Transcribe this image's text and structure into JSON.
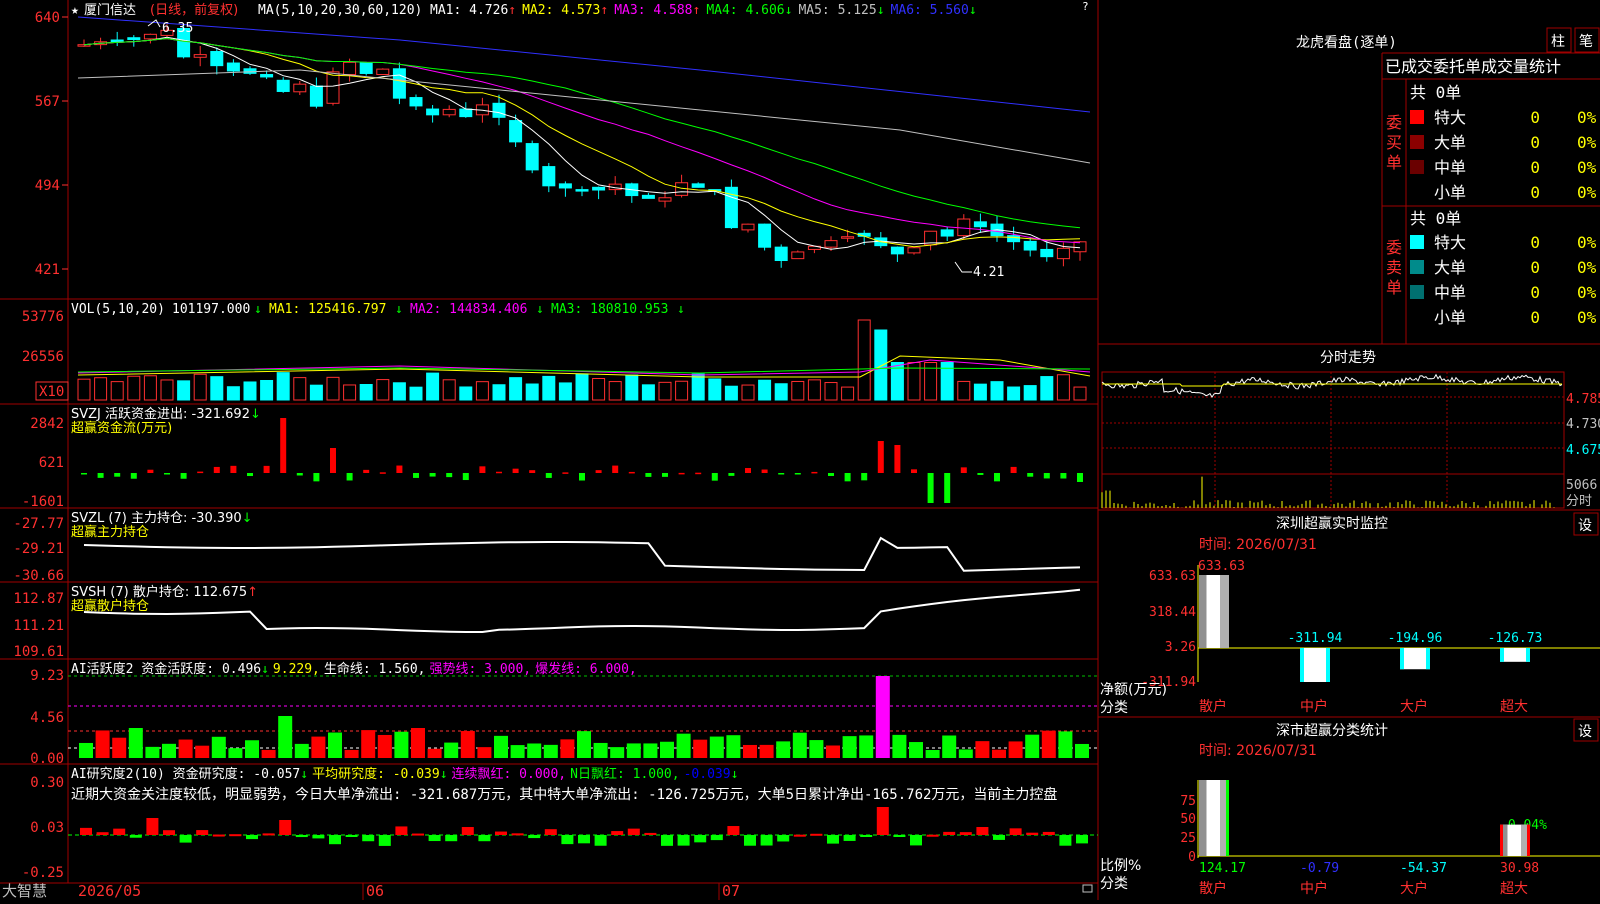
{
  "header": {
    "star": "★",
    "stock_name": "厦门信达",
    "period": "(日线，前复权)",
    "ma_label": "MA(5,10,20,30,60,120)",
    "ma_items": [
      {
        "label": "MA1:",
        "value": "4.726",
        "arrow": "↑",
        "color": "#ffffff"
      },
      {
        "label": "MA2:",
        "value": "4.573",
        "arrow": "↑",
        "color": "#ffff00"
      },
      {
        "label": "MA3:",
        "value": "4.588",
        "arrow": "↑",
        "color": "#ff00ff"
      },
      {
        "label": "MA4:",
        "value": "4.606",
        "arrow": "↓",
        "color": "#00ff00"
      },
      {
        "label": "MA5:",
        "value": "5.125",
        "arrow": "↓",
        "color": "#c0c0c0"
      },
      {
        "label": "MA6:",
        "value": "5.560",
        "arrow": "↓",
        "color": "#3030ff"
      }
    ],
    "high_mark": "6.35",
    "low_mark": "4.21"
  },
  "price_axis": [
    "640",
    "567",
    "494",
    "421"
  ],
  "vol": {
    "title": "VOL(5,10,20)",
    "value": "101197.000",
    "ma1": "MA1: 125416.797",
    "ma2": "MA2: 144834.406",
    "ma3": "MA3: 180810.953",
    "arrow": "↓",
    "axis": [
      "53776",
      "26556"
    ],
    "unit": "X10"
  },
  "svzj": {
    "title": "SVZJ  活跃资金进出: -321.692",
    "arrow": "↓",
    "subtitle": "超赢资金流(万元)",
    "axis": [
      "2842",
      "621",
      "-1601"
    ]
  },
  "svzl": {
    "title": "SVZL (7) 主力持仓: -30.390",
    "arrow": "↓",
    "subtitle": "超赢主力持仓",
    "axis": [
      "-27.77",
      "-29.21",
      "-30.66"
    ]
  },
  "svsh": {
    "title": "SVSH (7) 散户持仓: 112.675",
    "arrow": "↑",
    "subtitle": "超赢散户持仓",
    "axis": [
      "112.87",
      "111.21",
      "109.61"
    ]
  },
  "ai1": {
    "title": "AI活跃度2 资金活跃度: 0.496",
    "a1": "↓",
    "v2": "9.229,",
    "t3": "生命线: 1.560,",
    "t4": "强势线: 3.000,",
    "t5": "爆发线: 6.000,",
    "axis": [
      "9.23",
      "4.56",
      "0.00"
    ]
  },
  "ai2": {
    "title": "AI研究度2(10) 资金研究度: -0.057",
    "a1": "↓",
    "t2": "平均研究度: -0.039",
    "a2": "↓",
    "t3": "连续飘红: 0.000,",
    "t4": "N日飘红: 1.000,",
    "t5": "-0.039",
    "a5": "↓",
    "axis": [
      "0.30",
      "0.03",
      "-0.25"
    ],
    "comment": "近期大资金关注度较低，明显弱势，今日大单净流出: -321.687万元，其中特大单净流出: -126.725万元，大单5日累计净出-165.762万元，当前主力控盘"
  },
  "bottom": {
    "brand": "大智慧",
    "dates": [
      "2026/05",
      "06",
      "07"
    ]
  },
  "side": {
    "corner_mark": "?",
    "title": "龙虎看盘(逐单)",
    "btn_zhu": "柱",
    "btn_bi": "笔",
    "tabs_title": "已成交委托单成交量统计",
    "buy_side": "委买单",
    "sell_side": "委卖单",
    "buy_total": "共 0单",
    "sell_total": "共 0单",
    "buy_rows": [
      {
        "label": "特大",
        "value": "0",
        "pct": "0%",
        "color": "#ff0000"
      },
      {
        "label": "大单",
        "value": "0",
        "pct": "0%",
        "color": "#8b0000"
      },
      {
        "label": "中单",
        "value": "0",
        "pct": "0%",
        "color": "#6a0000"
      },
      {
        "label": "小单",
        "value": "0",
        "pct": "0%",
        "color": "#000000"
      }
    ],
    "sell_rows": [
      {
        "label": "特大",
        "value": "0",
        "pct": "0%",
        "color": "#00ffff"
      },
      {
        "label": "大单",
        "value": "0",
        "pct": "0%",
        "color": "#008b8b"
      },
      {
        "label": "中单",
        "value": "0",
        "pct": "0%",
        "color": "#007070"
      },
      {
        "label": "小单",
        "value": "0",
        "pct": "0%",
        "color": "#000000"
      }
    ],
    "intraday_title": "分时走势",
    "intraday_axis": [
      "4.785",
      "4.730",
      "4.675"
    ],
    "intraday_vol": "5066",
    "intraday_vol_unit": "分时",
    "monitor_title": "深圳超赢实时监控",
    "monitor_btn": "设",
    "monitor_time": "时间: 2026/07/31",
    "monitor_axis": [
      "633.63",
      "318.44",
      "3.26",
      "-311.94"
    ],
    "monitor_ylabel": "净额(万元)",
    "monitor_xlabel": "分类",
    "monitor_top": "633.63",
    "classify_title": "深市超赢分类统计",
    "classify_btn": "设",
    "classify_time": "时间: 2026/07/31",
    "classify_axis": [
      "75",
      "50",
      "25",
      "0"
    ],
    "classify_ylabel": "比例%",
    "classify_xlabel": "分类",
    "classify_note": "-0.04%"
  },
  "chart_data": [
    {
      "type": "bar",
      "title": "深圳超赢实时监控",
      "ylabel": "净额(万元)",
      "xlabel": "分类",
      "categories": [
        "散户",
        "中户",
        "大户",
        "超大"
      ],
      "values": [
        633.63,
        -311.94,
        -194.96,
        -126.73
      ],
      "labels": [
        "633.63",
        "-311.94",
        "-194.96",
        "-126.73"
      ],
      "ylim": [
        -311.94,
        633.63
      ]
    },
    {
      "type": "bar",
      "title": "深市超赢分类统计",
      "ylabel": "比例%",
      "xlabel": "分类",
      "categories": [
        "散户",
        "中户",
        "大户",
        "超大"
      ],
      "values": [
        124.17,
        -0.79,
        -54.37,
        30.98
      ],
      "labels": [
        "124.17",
        "-0.79",
        "-54.37",
        "30.98"
      ],
      "ylim": [
        0,
        75
      ]
    }
  ]
}
